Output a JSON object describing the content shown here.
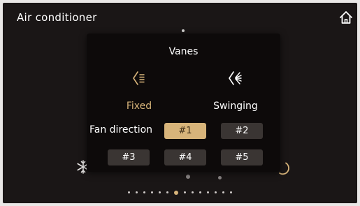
{
  "header": {
    "title": "Air conditioner",
    "home_icon": "home-icon"
  },
  "background": {
    "icons": [
      "snowflake-icon",
      "power-ring-icon"
    ]
  },
  "modal": {
    "title": "Vanes",
    "modes": [
      {
        "label": "Fixed",
        "icon": "vane-fixed-icon",
        "selected": true
      },
      {
        "label": "Swinging",
        "icon": "vane-swing-icon",
        "selected": false
      }
    ],
    "fan_direction": {
      "label": "Fan direction",
      "options": [
        {
          "label": "#1",
          "selected": true
        },
        {
          "label": "#2",
          "selected": false
        },
        {
          "label": "#3",
          "selected": false
        },
        {
          "label": "#4",
          "selected": false
        },
        {
          "label": "#5",
          "selected": false
        }
      ]
    }
  },
  "pager": {
    "count": 14,
    "active_index": 6
  },
  "colors": {
    "accent": "#d7b47a",
    "button": "#3a3533",
    "panel": "#0d0a0a",
    "screen": "#1a1616"
  }
}
